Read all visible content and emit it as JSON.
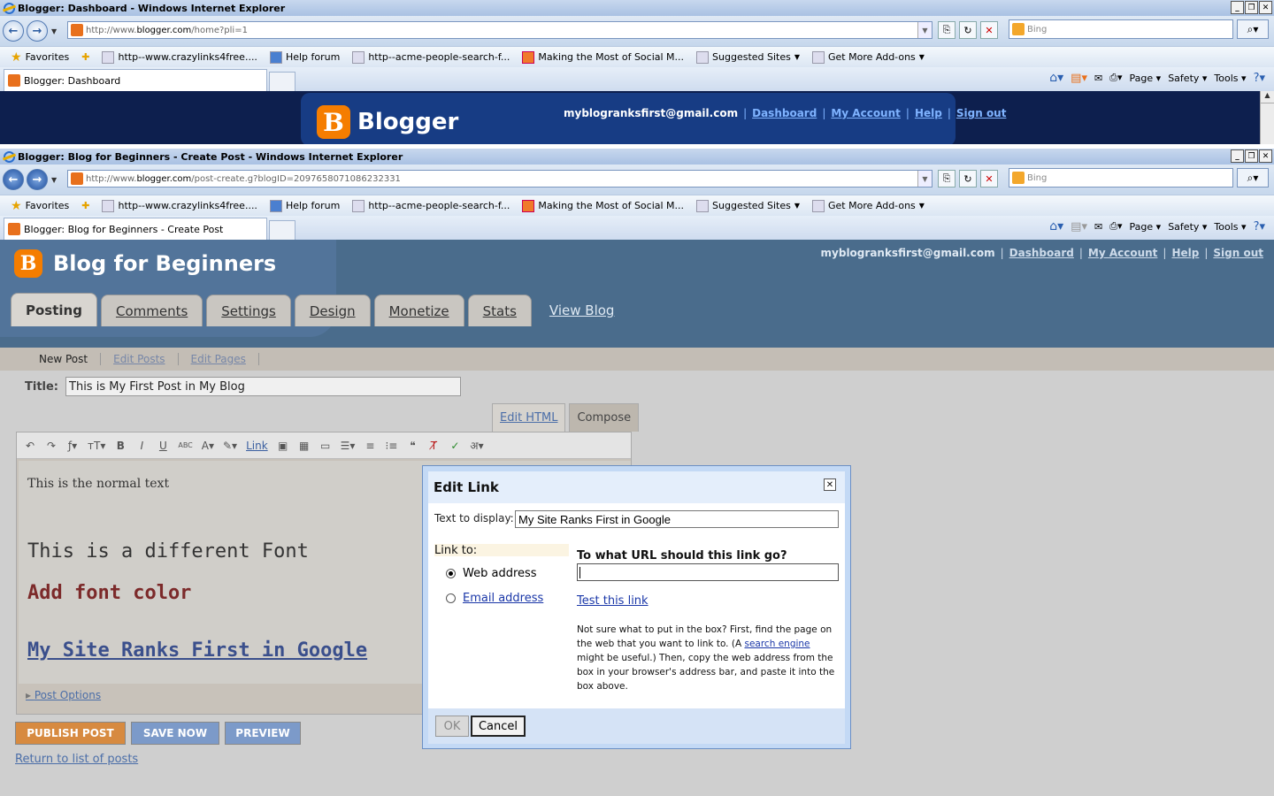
{
  "window1": {
    "title": "Blogger: Dashboard - Windows Internet Explorer",
    "url_prefix": "http://www.",
    "url_host": "blogger.com",
    "url_path": "/home?pli=1",
    "search_placeholder": "Bing",
    "tab_label": "Blogger: Dashboard",
    "brand": "Blogger",
    "header_links": {
      "email": "myblogranksfirst@gmail.com",
      "dashboard": "Dashboard",
      "account": "My Account",
      "help": "Help",
      "signout": "Sign out"
    }
  },
  "favorites": {
    "favorites_label": "Favorites",
    "items": [
      {
        "label": "http--www.crazylinks4free...."
      },
      {
        "label": "Help forum"
      },
      {
        "label": "http--acme-people-search-f..."
      },
      {
        "label": "Making the Most of Social M..."
      },
      {
        "label": "Suggested Sites"
      },
      {
        "label": "Get More Add-ons"
      }
    ]
  },
  "command_bar": {
    "page": "Page",
    "safety": "Safety",
    "tools": "Tools"
  },
  "window2": {
    "title": "Blogger: Blog for Beginners - Create Post - Windows Internet Explorer",
    "url_prefix": "http://www.",
    "url_host": "blogger.com",
    "url_path": "/post-create.g?blogID=2097658071086232331",
    "search_placeholder": "Bing",
    "tab_label": "Blogger: Blog for Beginners - Create Post",
    "blog_name": "Blog for Beginners",
    "header_links": {
      "email": "myblogranksfirst@gmail.com",
      "dashboard": "Dashboard",
      "account": "My Account",
      "help": "Help",
      "signout": "Sign out"
    },
    "tabs": {
      "posting": "Posting",
      "comments": "Comments",
      "settings": "Settings",
      "design": "Design",
      "monetize": "Monetize",
      "stats": "Stats",
      "view_blog": "View Blog"
    },
    "subnav": {
      "new_post": "New Post",
      "edit_posts": "Edit Posts",
      "edit_pages": "Edit Pages"
    },
    "title_label": "Title:",
    "title_value": "This is My First Post in My Blog",
    "mode_tabs": {
      "edit_html": "Edit HTML",
      "compose": "Compose"
    },
    "toolbar": {
      "link": "Link"
    },
    "content": {
      "line1": "This is the normal text",
      "line2": "This is a different Font",
      "line3": "Add font color",
      "line4": "My Site Ranks First in Google"
    },
    "post_options": "Post Options",
    "actions": {
      "publish": "PUBLISH POST",
      "save": "SAVE NOW",
      "preview": "PREVIEW"
    },
    "return_link": "Return to list of posts"
  },
  "dialog": {
    "title": "Edit Link",
    "text_to_display_label": "Text to display:",
    "text_to_display_value": "My Site Ranks First in Google",
    "link_to_label": "Link to:",
    "web_address": "Web address",
    "email_address": "Email address",
    "url_question": "To what URL should this link go?",
    "test_link": "Test this link",
    "help_part1": "Not sure what to put in the box? First, find the page on the web that you want to link to. (A ",
    "help_link": "search engine",
    "help_part2": " might be useful.) Then, copy the web address from the box in your browser's address bar, and paste it into the box above.",
    "ok": "OK",
    "cancel": "Cancel"
  }
}
